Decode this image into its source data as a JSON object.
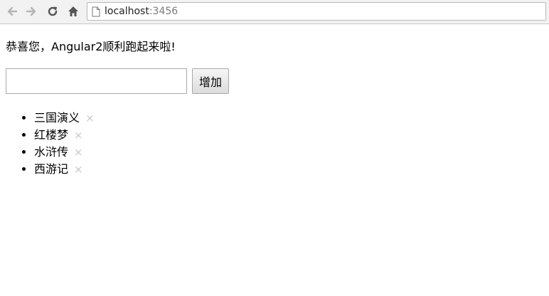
{
  "browser": {
    "url_host": "localhost",
    "url_port": ":3456",
    "icons": {
      "back": "back-arrow-icon",
      "forward": "forward-arrow-icon",
      "reload": "reload-icon",
      "home": "home-icon",
      "page": "page-icon"
    }
  },
  "page": {
    "greeting": "恭喜您，Angular2顺利跑起来啦!",
    "input_value": "",
    "add_button_label": "增加",
    "remove_glyph": "×",
    "books": [
      {
        "title": "三国演义"
      },
      {
        "title": "红楼梦"
      },
      {
        "title": "水浒传"
      },
      {
        "title": "西游记"
      }
    ]
  },
  "colors": {
    "chrome_bg": "#f2f2f2",
    "remove_icon": "#c8c8c8",
    "port_text": "#7a7a7a"
  }
}
